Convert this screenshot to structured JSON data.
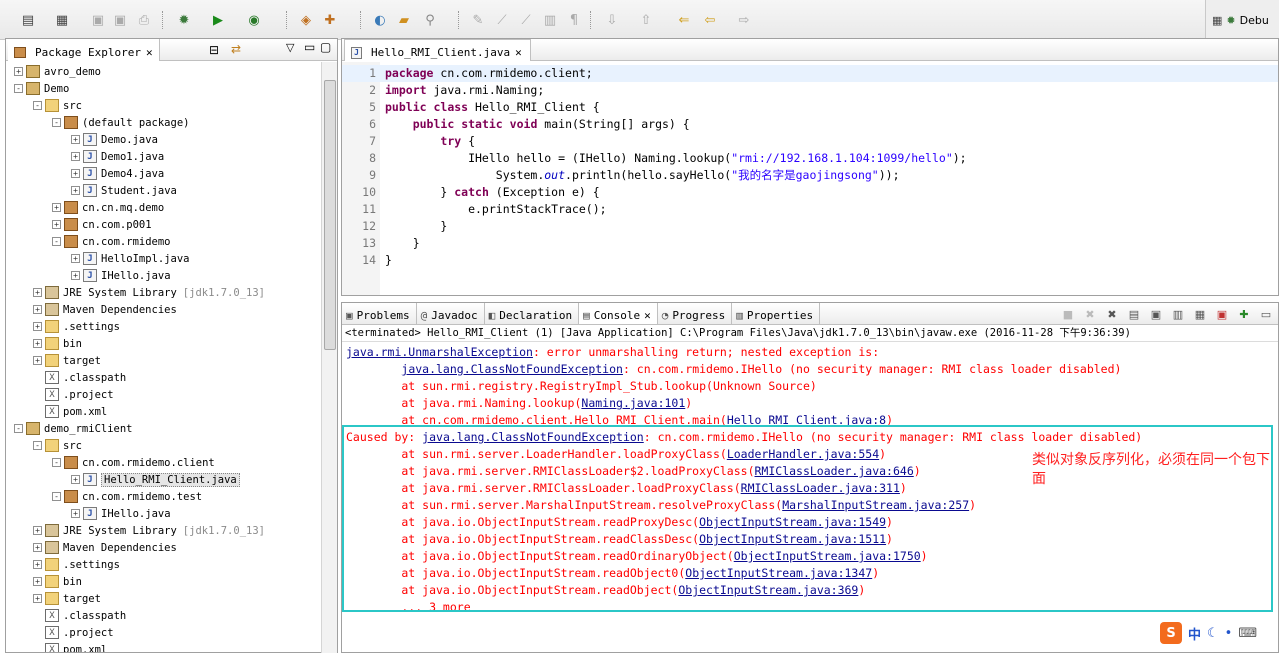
{
  "toolbar": {
    "perspective_label": "Debu"
  },
  "package_explorer": {
    "title": "Package Explorer",
    "rows": [
      {
        "label": "avro_demo",
        "icon": "project-icon",
        "depth": 0,
        "exp": "+"
      },
      {
        "label": "Demo",
        "icon": "project-icon",
        "depth": 0,
        "exp": "-"
      },
      {
        "label": "src",
        "icon": "source-folder-icon",
        "depth": 1,
        "exp": "-"
      },
      {
        "label": "(default package)",
        "icon": "package-icon",
        "depth": 2,
        "exp": "-"
      },
      {
        "label": "Demo.java",
        "icon": "java-file-icon",
        "depth": 3,
        "exp": "+"
      },
      {
        "label": "Demo1.java",
        "icon": "java-file-icon",
        "depth": 3,
        "exp": "+"
      },
      {
        "label": "Demo4.java",
        "icon": "java-file-icon",
        "depth": 3,
        "exp": "+"
      },
      {
        "label": "Student.java",
        "icon": "java-file-icon",
        "depth": 3,
        "exp": "+"
      },
      {
        "label": "cn.cn.mq.demo",
        "icon": "package-icon",
        "depth": 2,
        "exp": "+"
      },
      {
        "label": "cn.com.p001",
        "icon": "package-icon",
        "depth": 2,
        "exp": "+"
      },
      {
        "label": "cn.com.rmidemo",
        "icon": "package-icon",
        "depth": 2,
        "exp": "-"
      },
      {
        "label": "HelloImpl.java",
        "icon": "java-file-icon",
        "depth": 3,
        "exp": "+"
      },
      {
        "label": "IHello.java",
        "icon": "java-file-icon",
        "depth": 3,
        "exp": "+"
      },
      {
        "label": "JRE System Library",
        "suffix": "[jdk1.7.0_13]",
        "icon": "library-icon",
        "depth": 1,
        "exp": "+"
      },
      {
        "label": "Maven Dependencies",
        "icon": "library-icon",
        "depth": 1,
        "exp": "+"
      },
      {
        "label": ".settings",
        "icon": "folder-icon",
        "depth": 1,
        "exp": "+"
      },
      {
        "label": "bin",
        "icon": "folder-icon",
        "depth": 1,
        "exp": "+"
      },
      {
        "label": "target",
        "icon": "folder-icon",
        "depth": 1,
        "exp": "+"
      },
      {
        "label": ".classpath",
        "icon": "xml-file-icon",
        "depth": 1,
        "exp": ""
      },
      {
        "label": ".project",
        "icon": "xml-file-icon",
        "depth": 1,
        "exp": ""
      },
      {
        "label": "pom.xml",
        "icon": "xml-file-icon",
        "depth": 1,
        "exp": ""
      },
      {
        "label": "demo_rmiClient",
        "icon": "project-icon",
        "depth": 0,
        "exp": "-"
      },
      {
        "label": "src",
        "icon": "source-folder-icon",
        "depth": 1,
        "exp": "-"
      },
      {
        "label": "cn.com.rmidemo.client",
        "icon": "package-icon",
        "depth": 2,
        "exp": "-"
      },
      {
        "label": "Hello_RMI_Client.java",
        "icon": "java-file-icon",
        "depth": 3,
        "exp": "+",
        "selected": true
      },
      {
        "label": "cn.com.rmidemo.test",
        "icon": "package-icon",
        "depth": 2,
        "exp": "-"
      },
      {
        "label": "IHello.java",
        "icon": "java-file-icon",
        "depth": 3,
        "exp": "+"
      },
      {
        "label": "JRE System Library",
        "suffix": "[jdk1.7.0_13]",
        "icon": "library-icon",
        "depth": 1,
        "exp": "+"
      },
      {
        "label": "Maven Dependencies",
        "icon": "library-icon",
        "depth": 1,
        "exp": "+"
      },
      {
        "label": ".settings",
        "icon": "folder-icon",
        "depth": 1,
        "exp": "+"
      },
      {
        "label": "bin",
        "icon": "folder-icon",
        "depth": 1,
        "exp": "+"
      },
      {
        "label": "target",
        "icon": "folder-icon",
        "depth": 1,
        "exp": "+"
      },
      {
        "label": ".classpath",
        "icon": "xml-file-icon",
        "depth": 1,
        "exp": ""
      },
      {
        "label": ".project",
        "icon": "xml-file-icon",
        "depth": 1,
        "exp": ""
      },
      {
        "label": "pom.xml",
        "icon": "xml-file-icon",
        "depth": 1,
        "exp": ""
      }
    ]
  },
  "editor": {
    "tab_label": "Hello_RMI_Client.java",
    "lines": [
      {
        "num": "1",
        "html": "<span class=\"kw\">package</span> cn.com.rmidemo.client;"
      },
      {
        "num": "2",
        "html": "<span class=\"kw\">import</span> java.rmi.Naming;"
      },
      {
        "num": "5",
        "html": "<span class=\"kw\">public</span> <span class=\"kw\">class</span> Hello_RMI_Client {"
      },
      {
        "num": "6",
        "html": "    <span class=\"kw\">public</span> <span class=\"kw\">static</span> <span class=\"kw\">void</span> main(String[] args) {"
      },
      {
        "num": "7",
        "html": "        <span class=\"kw\">try</span> {"
      },
      {
        "num": "8",
        "html": "            IHello hello = (IHello) Naming.lookup(<span class=\"str\">\"rmi://192.168.1.104:1099/hello\"</span>);"
      },
      {
        "num": "9",
        "html": "                System.<span class=\"field\">out</span>.println(hello.sayHello(<span class=\"str\">\"我的名字是gaojingsong\"</span>));"
      },
      {
        "num": "10",
        "html": "        } <span class=\"kw\">catch</span> (Exception e) {"
      },
      {
        "num": "11",
        "html": "            e.printStackTrace();"
      },
      {
        "num": "12",
        "html": "        }"
      },
      {
        "num": "13",
        "html": "    }"
      },
      {
        "num": "14",
        "html": "}"
      }
    ]
  },
  "console": {
    "tabs": [
      {
        "label": "Problems",
        "icon": "problems-icon"
      },
      {
        "label": "Javadoc",
        "icon": "javadoc-icon"
      },
      {
        "label": "Declaration",
        "icon": "declaration-icon"
      },
      {
        "label": "Console",
        "icon": "console-icon",
        "active": true
      },
      {
        "label": "Progress",
        "icon": "progress-icon"
      },
      {
        "label": "Properties",
        "icon": "properties-icon"
      }
    ],
    "status": "<terminated> Hello_RMI_Client (1) [Java Application] C:\\Program Files\\Java\\jdk1.7.0_13\\bin\\javaw.exe (2016-11-28 下午9:36:39)",
    "output": [
      {
        "pre": "",
        "link": "java.rmi.UnmarshalException",
        "post": ": error unmarshalling return; nested exception is:"
      },
      {
        "pre": "\t",
        "link": "java.lang.ClassNotFoundException",
        "post": ": cn.com.rmidemo.IHello (no security manager: RMI class loader disabled)"
      },
      {
        "pre": "\tat sun.rmi.registry.RegistryImpl_Stub.lookup(Unknown Source)",
        "link": "",
        "post": ""
      },
      {
        "pre": "\tat java.rmi.Naming.lookup(",
        "link": "Naming.java:101",
        "post": ")"
      },
      {
        "pre": "\tat cn.com.rmidemo.client.Hello_RMI_Client.main(",
        "link": "Hello_RMI_Client.java:8",
        "post": ")"
      },
      {
        "pre": "Caused by: ",
        "link": "java.lang.ClassNotFoundException",
        "post": ": cn.com.rmidemo.IHello (no security manager: RMI class loader disabled)"
      },
      {
        "pre": "\tat sun.rmi.server.LoaderHandler.loadProxyClass(",
        "link": "LoaderHandler.java:554",
        "post": ")"
      },
      {
        "pre": "\tat java.rmi.server.RMIClassLoader$2.loadProxyClass(",
        "link": "RMIClassLoader.java:646",
        "post": ")"
      },
      {
        "pre": "\tat java.rmi.server.RMIClassLoader.loadProxyClass(",
        "link": "RMIClassLoader.java:311",
        "post": ")"
      },
      {
        "pre": "\tat sun.rmi.server.MarshalInputStream.resolveProxyClass(",
        "link": "MarshalInputStream.java:257",
        "post": ")"
      },
      {
        "pre": "\tat java.io.ObjectInputStream.readProxyDesc(",
        "link": "ObjectInputStream.java:1549",
        "post": ")"
      },
      {
        "pre": "\tat java.io.ObjectInputStream.readClassDesc(",
        "link": "ObjectInputStream.java:1511",
        "post": ")"
      },
      {
        "pre": "\tat java.io.ObjectInputStream.readOrdinaryObject(",
        "link": "ObjectInputStream.java:1750",
        "post": ")"
      },
      {
        "pre": "\tat java.io.ObjectInputStream.readObject0(",
        "link": "ObjectInputStream.java:1347",
        "post": ")"
      },
      {
        "pre": "\tat java.io.ObjectInputStream.readObject(",
        "link": "ObjectInputStream.java:369",
        "post": ")"
      },
      {
        "pre": "\t... 3 more",
        "link": "",
        "post": ""
      }
    ],
    "annotation": "类似对象反序列化，必须在同一个包下面"
  },
  "ime": {
    "logo": "S",
    "mode": "中"
  },
  "colors": {
    "error_text": "#ff0000",
    "annotation_border": "#2bc7c7",
    "keyword": "#7f0055",
    "string": "#2a00ff"
  }
}
